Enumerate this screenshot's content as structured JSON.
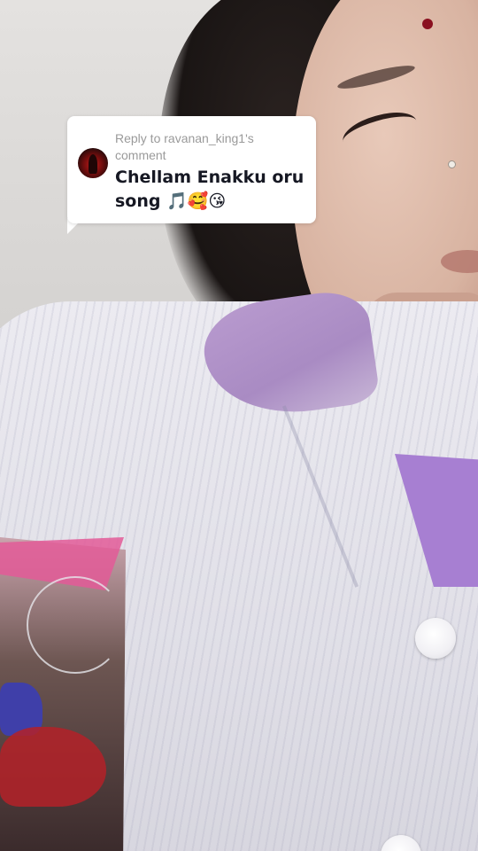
{
  "reply_bubble": {
    "header": "Reply to ravanan_king1's comment",
    "comment": "Chellam Enakku oru song 🎵🥰😘"
  },
  "colors": {
    "bubble_bg": "#ffffff",
    "header_text": "#9a9a9a",
    "comment_text": "#161823"
  }
}
